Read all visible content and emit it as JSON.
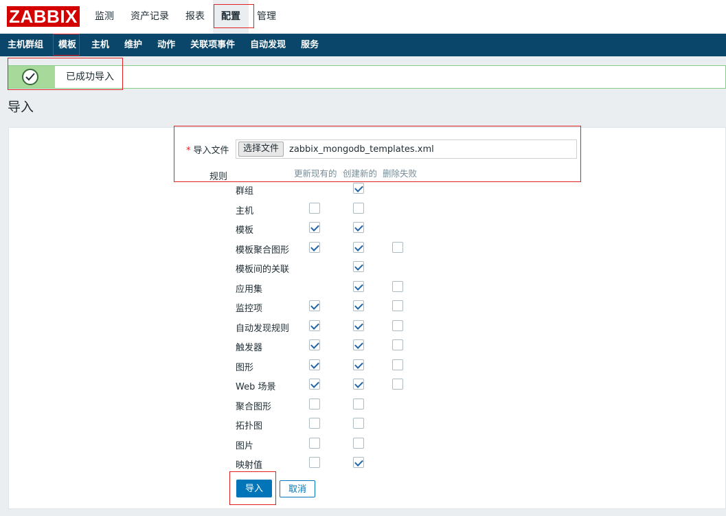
{
  "logo": {
    "text": "ZABBIX"
  },
  "topnav": {
    "items": [
      "监测",
      "资产记录",
      "报表",
      "配置",
      "管理"
    ],
    "active": "配置"
  },
  "subnav": {
    "items": [
      "主机群组",
      "模板",
      "主机",
      "维护",
      "动作",
      "关联项事件",
      "自动发现",
      "服务"
    ],
    "active": "模板"
  },
  "message": {
    "text": "已成功导入",
    "icon": "check-circle-icon"
  },
  "page": {
    "title": "导入"
  },
  "form": {
    "file_label": "导入文件",
    "file_button": "选择文件",
    "file_name": "zabbix_mongodb_templates.xml",
    "rules_label": "规则",
    "columns": [
      "更新现有的",
      "创建新的",
      "删除失败"
    ],
    "rows": [
      {
        "label": "群组",
        "update": null,
        "create": true,
        "delete": null
      },
      {
        "label": "主机",
        "update": false,
        "create": false,
        "delete": null
      },
      {
        "label": "模板",
        "update": true,
        "create": true,
        "delete": null
      },
      {
        "label": "模板聚合图形",
        "update": true,
        "create": true,
        "delete": false
      },
      {
        "label": "模板间的关联",
        "update": null,
        "create": true,
        "delete": null
      },
      {
        "label": "应用集",
        "update": null,
        "create": true,
        "delete": false
      },
      {
        "label": "监控项",
        "update": true,
        "create": true,
        "delete": false
      },
      {
        "label": "自动发现规则",
        "update": true,
        "create": true,
        "delete": false
      },
      {
        "label": "触发器",
        "update": true,
        "create": true,
        "delete": false
      },
      {
        "label": "图形",
        "update": true,
        "create": true,
        "delete": false
      },
      {
        "label": "Web 场景",
        "update": true,
        "create": true,
        "delete": false
      },
      {
        "label": "聚合图形",
        "update": false,
        "create": false,
        "delete": null
      },
      {
        "label": "拓扑图",
        "update": false,
        "create": false,
        "delete": null
      },
      {
        "label": "图片",
        "update": false,
        "create": false,
        "delete": null
      },
      {
        "label": "映射值",
        "update": false,
        "create": true,
        "delete": null
      }
    ],
    "import_button": "导入",
    "cancel_button": "取消"
  },
  "colors": {
    "brand": "#d40000",
    "nav": "#0a466a",
    "primary": "#0275b8",
    "success": "#a6d99a"
  }
}
